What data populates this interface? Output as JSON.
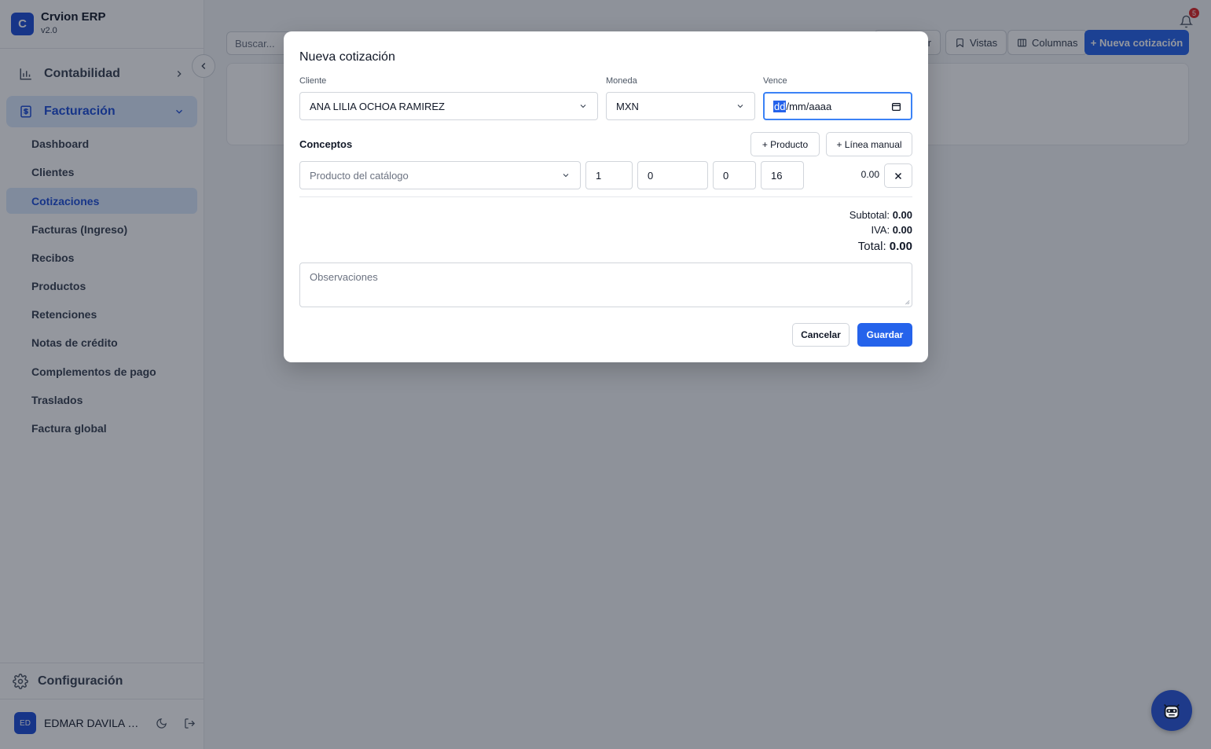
{
  "app": {
    "name": "Crvion ERP",
    "version": "v2.0",
    "logo_letter": "C"
  },
  "sidebar": {
    "groups": [
      {
        "label": "Contabilidad",
        "icon": "bar-chart-icon",
        "expanded": false
      },
      {
        "label": "Facturación",
        "icon": "invoice-dollar-icon",
        "expanded": true
      }
    ],
    "items": [
      {
        "label": "Dashboard"
      },
      {
        "label": "Clientes"
      },
      {
        "label": "Cotizaciones",
        "active": true
      },
      {
        "label": "Facturas (Ingreso)"
      },
      {
        "label": "Recibos"
      },
      {
        "label": "Productos"
      },
      {
        "label": "Retenciones"
      },
      {
        "label": "Notas de crédito"
      },
      {
        "label": "Complementos de pago"
      },
      {
        "label": "Traslados"
      },
      {
        "label": "Factura global"
      }
    ],
    "config_label": "Configuración",
    "user": {
      "initials": "ED",
      "name": "EDMAR DAVILA R..."
    }
  },
  "toolbar": {
    "search_placeholder": "Buscar...",
    "partial_button_tail": "r",
    "views_label": "Vistas",
    "columns_label": "Columnas",
    "new_label": "+ Nueva cotización"
  },
  "notifications": {
    "count": "5"
  },
  "modal": {
    "title": "Nueva cotización",
    "client_label": "Cliente",
    "client_value": "ANA LILIA OCHOA RAMIREZ",
    "currency_label": "Moneda",
    "currency_value": "MXN",
    "due_label": "Vence",
    "due_placeholder_day": "dd",
    "due_placeholder_rest": "/mm/aaaa",
    "concepts_label": "Conceptos",
    "add_product_label": "+ Producto",
    "add_manual_label": "+ Línea manual",
    "line": {
      "product_placeholder": "Producto del catálogo",
      "qty": "1",
      "price": "0",
      "discount": "0",
      "tax": "16",
      "total": "0.00"
    },
    "subtotal_label": "Subtotal:",
    "subtotal_value": "0.00",
    "iva_label": "IVA:",
    "iva_value": "0.00",
    "total_label": "Total:",
    "total_value": "0.00",
    "notes_placeholder": "Observaciones",
    "cancel_label": "Cancelar",
    "save_label": "Guardar"
  },
  "colors": {
    "primary": "#2563eb",
    "active_bg": "#dbeafe",
    "badge": "#dc2626"
  }
}
